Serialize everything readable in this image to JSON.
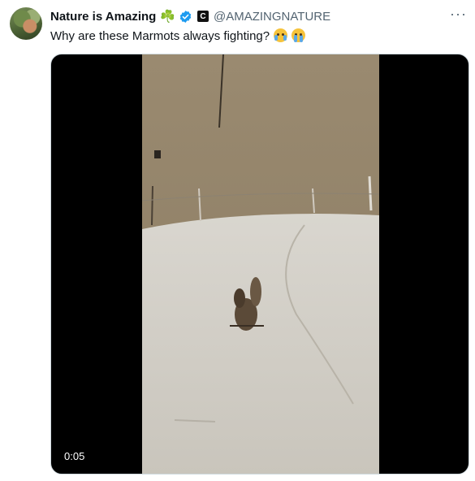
{
  "account": {
    "display_name": "Nature is Amazing",
    "name_emoji": "☘️",
    "affiliate_badge": "C",
    "handle": "@AMAZINGNATURE",
    "avatar_icon": "user-avatar-icon",
    "verified_icon": "verified-badge-icon"
  },
  "tweet": {
    "text": "Why are these Marmots always fighting?",
    "emojis": [
      "face-with-tears-of-joy-icon",
      "loudly-crying-face-icon"
    ]
  },
  "menu": {
    "more_label": "···"
  },
  "media": {
    "type": "video",
    "timestamp": "0:05",
    "scene": "marmots-on-road"
  },
  "colors": {
    "verified": "#1d9bf0",
    "handle": "#536471",
    "text": "#0f1419"
  }
}
